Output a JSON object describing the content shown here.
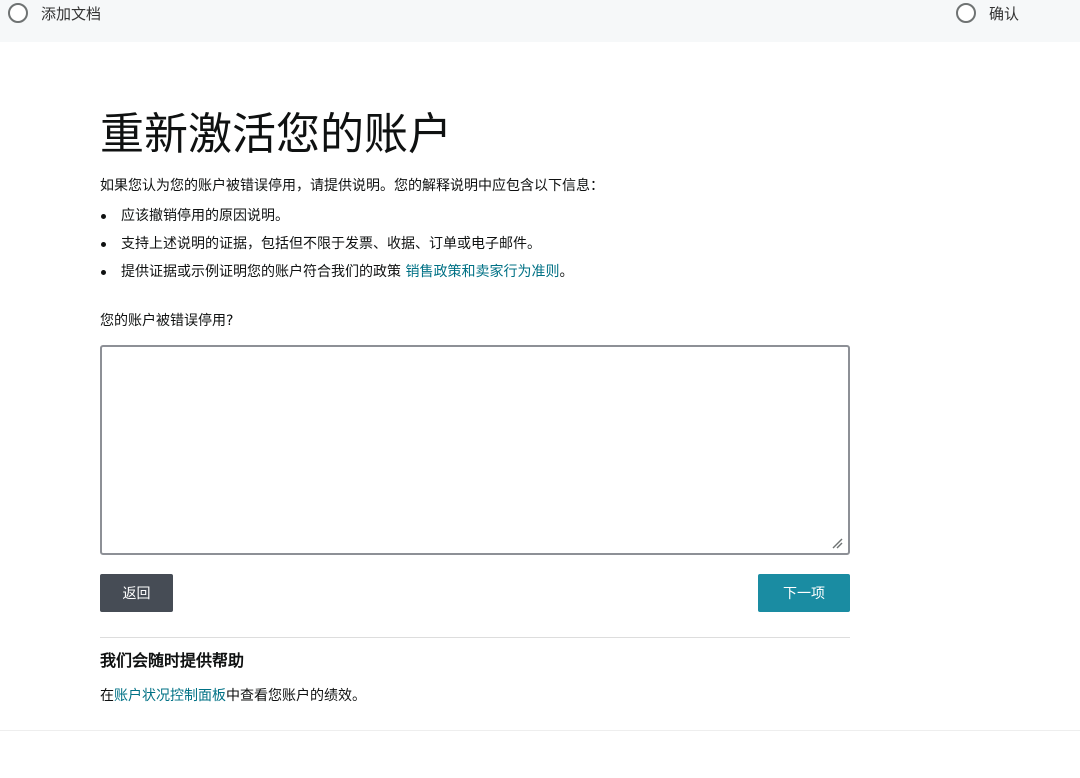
{
  "stepper": {
    "steps": [
      {
        "label": "添加文档",
        "icon": "radio-circle-icon"
      },
      {
        "label": "确认",
        "icon": "radio-circle-icon"
      }
    ]
  },
  "main": {
    "title": "重新激活您的账户",
    "intro": "如果您认为您的账户被错误停用，请提供说明。您的解释说明中应包含以下信息：",
    "bullets": [
      "应该撤销停用的原因说明。",
      "支持上述说明的证据，包括但不限于发票、收据、订单或电子邮件。",
      "提供证据或示例证明您的账户符合我们的政策 "
    ],
    "policy_link": "销售政策和卖家行为准则",
    "policy_suffix": "。",
    "question": "您的账户被错误停用?",
    "textarea_value": "",
    "back_label": "返回",
    "next_label": "下一项"
  },
  "help": {
    "title": "我们会随时提供帮助",
    "text_prefix": "在",
    "link": "账户状况控制面板",
    "text_suffix": "中查看您账户的绩效。"
  },
  "colors": {
    "link": "#007185",
    "next_button": "#1a8ca2",
    "back_button": "#464c55"
  }
}
